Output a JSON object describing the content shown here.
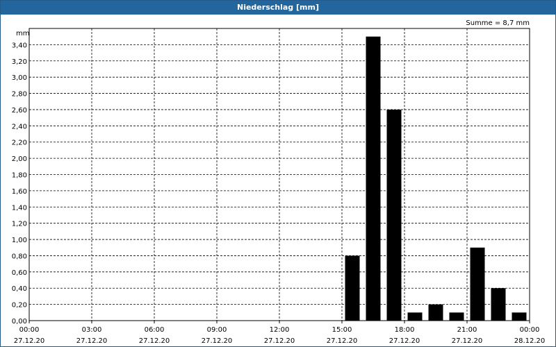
{
  "window": {
    "title": "Niederschlag [mm]"
  },
  "chart_data": {
    "type": "bar",
    "title": "Niederschlag [mm]",
    "ylabel": "mm",
    "annotation": "Summe = 8,7 mm",
    "ylim": [
      0,
      3.6
    ],
    "grid": true,
    "y_ticks": [
      "0,00",
      "0,20",
      "0,40",
      "0,60",
      "0,80",
      "1,00",
      "1,20",
      "1,40",
      "1,60",
      "1,80",
      "2,00",
      "2,20",
      "2,40",
      "2,60",
      "2,80",
      "3,00",
      "3,20",
      "3,40"
    ],
    "x_ticks": [
      {
        "time": "00:00",
        "date": "27.12.20"
      },
      {
        "time": "03:00",
        "date": "27.12.20"
      },
      {
        "time": "06:00",
        "date": "27.12.20"
      },
      {
        "time": "09:00",
        "date": "27.12.20"
      },
      {
        "time": "12:00",
        "date": "27.12.20"
      },
      {
        "time": "15:00",
        "date": "27.12.20"
      },
      {
        "time": "18:00",
        "date": "27.12.20"
      },
      {
        "time": "21:00",
        "date": "27.12.20"
      },
      {
        "time": "00:00",
        "date": "28.12.20"
      }
    ],
    "x_range": [
      0,
      24
    ],
    "bar_width_hours": 0.7,
    "bars": [
      {
        "x": 15.5,
        "value": 0.8
      },
      {
        "x": 16.5,
        "value": 3.5
      },
      {
        "x": 17.5,
        "value": 2.6
      },
      {
        "x": 18.5,
        "value": 0.1
      },
      {
        "x": 19.5,
        "value": 0.2
      },
      {
        "x": 20.5,
        "value": 0.1
      },
      {
        "x": 21.5,
        "value": 0.9
      },
      {
        "x": 22.5,
        "value": 0.4
      },
      {
        "x": 23.5,
        "value": 0.1
      }
    ]
  }
}
